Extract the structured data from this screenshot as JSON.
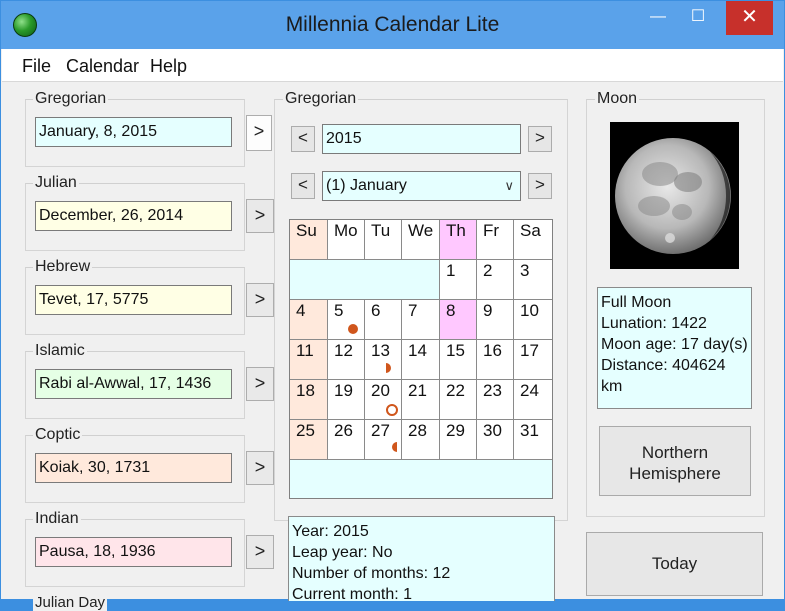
{
  "window": {
    "title": "Millennia Calendar Lite",
    "min_glyph": "—",
    "max_glyph": "☐",
    "close_glyph": "✕"
  },
  "menu": [
    "File",
    "Calendar",
    "Help"
  ],
  "left_panels": [
    {
      "label": "Gregorian",
      "value": "January, 8, 2015",
      "color": "#e5ffff"
    },
    {
      "label": "Julian",
      "value": "December, 26, 2014",
      "color": "#ffffe5"
    },
    {
      "label": "Hebrew",
      "value": "Tevet, 17, 5775",
      "color": "#ffffe5"
    },
    {
      "label": "Islamic",
      "value": "Rabi al-Awwal, 17, 1436",
      "color": "#e5ffe5"
    },
    {
      "label": "Coptic",
      "value": "Koiak, 30, 1731",
      "color": "#ffe9dc"
    },
    {
      "label": "Indian",
      "value": "Pausa, 18, 1936",
      "color": "#ffe5ea"
    }
  ],
  "left_partial_label": "Julian Day",
  "go_button": ">",
  "center": {
    "label": "Gregorian",
    "year": "2015",
    "month": "(1) January",
    "prev": "<",
    "next": ">",
    "weekdays": [
      "Su",
      "Mo",
      "Tu",
      "We",
      "Th",
      "Fr",
      "Sa"
    ],
    "weeks": [
      [
        "",
        "",
        "",
        "",
        "1",
        "2",
        "3"
      ],
      [
        "4",
        "5",
        "6",
        "7",
        "8",
        "9",
        "10"
      ],
      [
        "11",
        "12",
        "13",
        "14",
        "15",
        "16",
        "17"
      ],
      [
        "18",
        "19",
        "20",
        "21",
        "22",
        "23",
        "24"
      ],
      [
        "25",
        "26",
        "27",
        "28",
        "29",
        "30",
        "31"
      ]
    ],
    "info": [
      "Year: 2015",
      "Leap year: No",
      "Number of months: 12",
      "Current month: 1"
    ]
  },
  "moon": {
    "label": "Moon",
    "phase": "Full Moon",
    "lunation": "Lunation: 1422",
    "age": "Moon age: 17 day(s)",
    "distance": "Distance: 404624 km",
    "hemisphere_line1": "Northern",
    "hemisphere_line2": "Hemisphere",
    "today": "Today"
  }
}
